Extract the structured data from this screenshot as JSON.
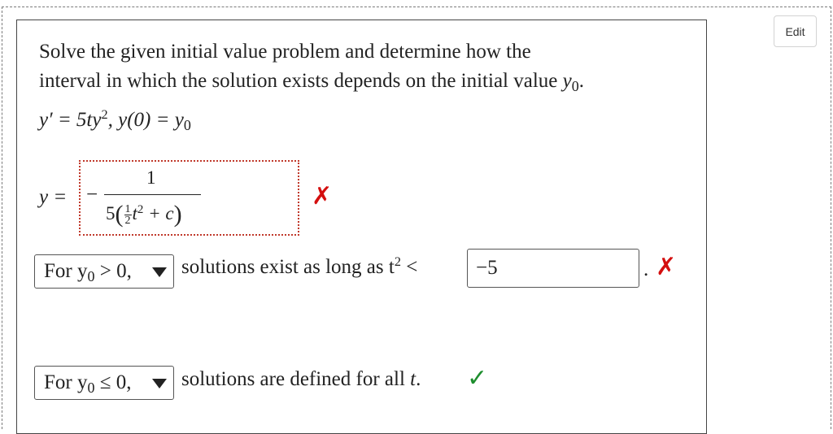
{
  "toolbar": {
    "edit_label": "Edit"
  },
  "problem": {
    "line1": "Solve the given initial value problem and determine how the",
    "line2_prefix": "interval in which the solution exists depends on the initial value ",
    "y0_var": "y",
    "y0_sub": "0",
    "line2_suffix": "."
  },
  "equation": {
    "lhs": "y′ = 5ty",
    "exp": "2",
    "mid": ",  y(0) = y",
    "sub": "0"
  },
  "answer": {
    "label": "y =",
    "minus": "−",
    "numerator": "1",
    "den_coef": "5",
    "half_num": "1",
    "half_den": "2",
    "den_t": "t",
    "den_exp": "2",
    "den_rest": " + c",
    "status": "incorrect"
  },
  "case1": {
    "select_prefix": "For y",
    "select_sub": "0",
    "select_rel": " > 0,",
    "text": "solutions exist as long as t",
    "text_exp": "2",
    "text_rel": " <",
    "input_value": "−5",
    "status": "incorrect"
  },
  "case2": {
    "select_prefix": "For y",
    "select_sub": "0",
    "select_rel": " ≤ 0,",
    "text": "solutions are defined for all ",
    "text_var": "t",
    "text_end": ".",
    "status": "correct"
  },
  "marks": {
    "cross": "✗",
    "check": "✓"
  },
  "colors": {
    "incorrect": "#d40f0f",
    "correct": "#1e8e2e",
    "answer_border": "#c0392b"
  }
}
